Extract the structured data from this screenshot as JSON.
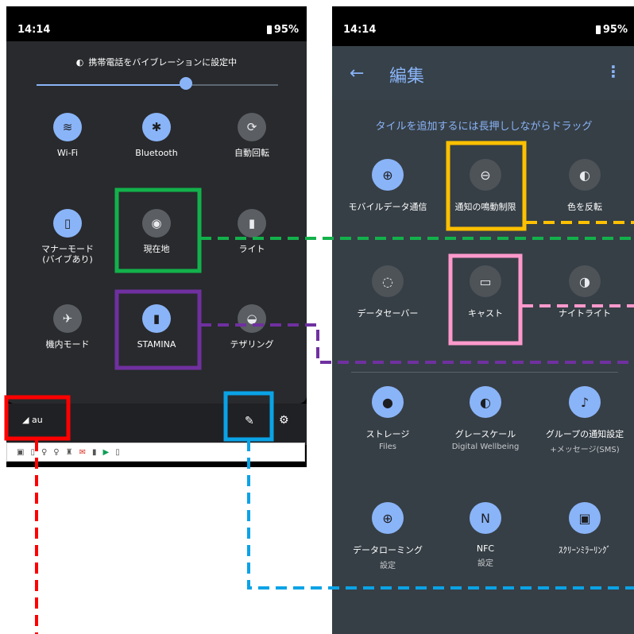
{
  "left_phone": {
    "time": "14:14",
    "battery": "95%",
    "vibration_text": "携帯電話をバイブレーションに設定中",
    "brightness_level": 0.62,
    "tiles": [
      {
        "label": "Wi-Fi",
        "icon": "wifi-question-icon",
        "state": "on"
      },
      {
        "label": "Bluetooth",
        "icon": "bluetooth-icon",
        "state": "on"
      },
      {
        "label": "自動回転",
        "icon": "auto-rotate-icon",
        "state": "off"
      },
      {
        "label": "マナーモード\n(バイブあり)",
        "icon": "vibrate-icon",
        "state": "on"
      },
      {
        "label": "現在地",
        "icon": "location-pin-icon",
        "state": "off"
      },
      {
        "label": "ライト",
        "icon": "flashlight-icon",
        "state": "off"
      },
      {
        "label": "機内モード",
        "icon": "airplane-icon",
        "state": "off"
      },
      {
        "label": "STAMINA",
        "icon": "battery-stamina-icon",
        "state": "on"
      },
      {
        "label": "テザリング",
        "icon": "hotspot-icon",
        "state": "off"
      }
    ],
    "carrier": "au"
  },
  "right_phone": {
    "time": "14:14",
    "battery": "95%",
    "title": "編集",
    "hint": "タイルを追加するには長押ししながらドラッグ",
    "tiles": [
      {
        "label": "モバイルデータ通信",
        "sub": "",
        "icon": "globe-icon",
        "state": "on"
      },
      {
        "label": "通知の鳴動制限",
        "sub": "",
        "icon": "do-not-disturb-icon",
        "state": "off"
      },
      {
        "label": "色を反転",
        "sub": "",
        "icon": "invert-colors-icon",
        "state": "off"
      },
      {
        "label": "データセーバー",
        "sub": "",
        "icon": "data-saver-icon",
        "state": "off"
      },
      {
        "label": "キャスト",
        "sub": "",
        "icon": "cast-icon",
        "state": "off"
      },
      {
        "label": "ナイトライト",
        "sub": "",
        "icon": "night-light-icon",
        "state": "off"
      },
      {
        "label": "ストレージ",
        "sub": "Files",
        "icon": "storage-icon",
        "state": "on"
      },
      {
        "label": "グレースケール",
        "sub": "Digital Wellbeing",
        "icon": "grayscale-icon",
        "state": "on"
      },
      {
        "label": "グループの通知設定",
        "sub": "+メッセージ(SMS)",
        "icon": "group-notify-icon",
        "state": "on"
      },
      {
        "label": "データローミング",
        "sub": "設定",
        "icon": "data-roaming-icon",
        "state": "on"
      },
      {
        "label": "NFC",
        "sub": "設定",
        "icon": "nfc-icon",
        "state": "on"
      },
      {
        "label": "ｽｸﾘｰﾝﾐﾗｰﾘﾝｸﾞ",
        "sub": "",
        "icon": "screen-mirroring-icon",
        "state": "on"
      }
    ]
  },
  "colors": {
    "green": "#12b14b",
    "purple": "#7030a0",
    "red": "#ff0000",
    "blue": "#0aa3e6",
    "yellow": "#ffc000",
    "pink": "#ff99cc",
    "accent": "#8ab4f8"
  }
}
